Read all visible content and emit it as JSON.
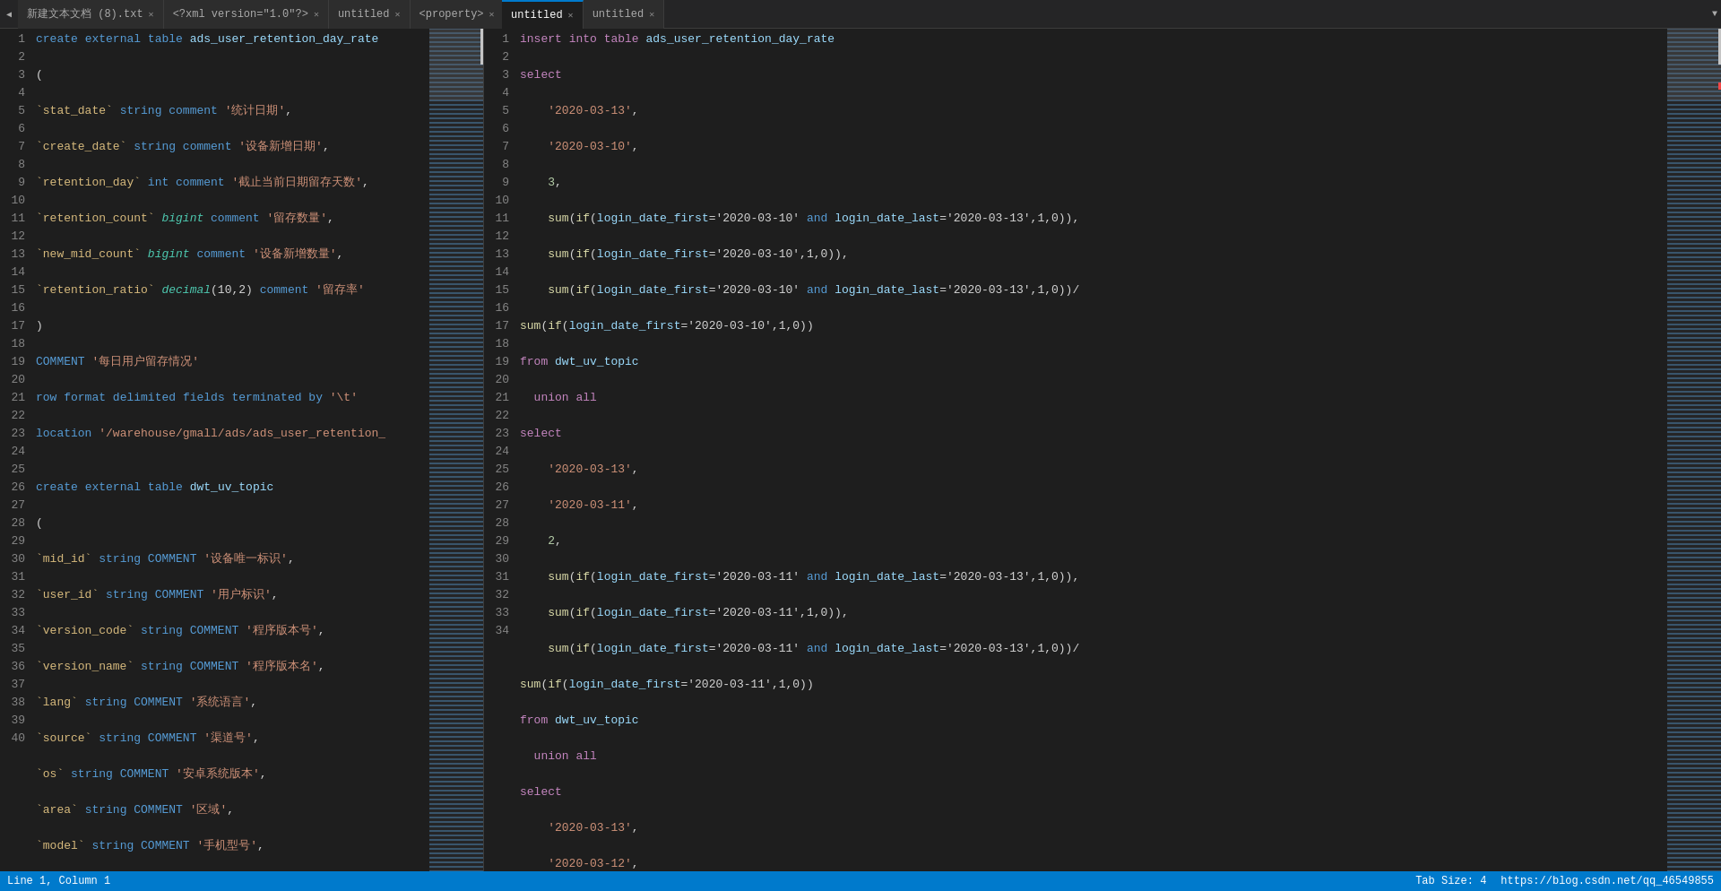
{
  "tabs_left": [
    {
      "label": "新建文本文档 (8).txt",
      "active": false,
      "closable": true
    },
    {
      "label": "<?xml version=\"1.0\"?>",
      "active": false,
      "closable": true
    },
    {
      "label": "untitled",
      "active": false,
      "closable": true
    },
    {
      "label": "<property>",
      "active": false,
      "closable": true
    }
  ],
  "tabs_right": [
    {
      "label": "untitled",
      "active": true,
      "closable": true
    },
    {
      "label": "untitled",
      "active": false,
      "closable": true
    }
  ],
  "status": {
    "left": "Line 1, Column 1",
    "right_tab": "Tab Size: 4",
    "link": "https://blog.csdn.net/qq_46549855"
  }
}
